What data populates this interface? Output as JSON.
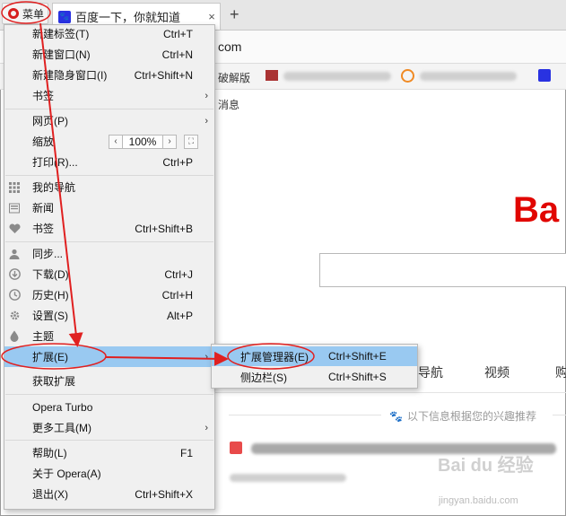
{
  "browser": {
    "menu_button_label": "菜单",
    "tab_title": "百度一下，你就知道",
    "tab_close": "×",
    "new_tab": "+",
    "address_text": "com",
    "bookmark_text": "破解版",
    "page_message": "消息"
  },
  "menu": {
    "items": [
      {
        "label": "新建标签(T)",
        "shortcut": "Ctrl+T",
        "icon": ""
      },
      {
        "label": "新建窗口(N)",
        "shortcut": "Ctrl+N",
        "icon": ""
      },
      {
        "label": "新建隐身窗口(I)",
        "shortcut": "Ctrl+Shift+N",
        "icon": ""
      },
      {
        "label": "书签",
        "shortcut": "",
        "icon": "",
        "submenu": true
      },
      {
        "label": "网页(P)",
        "shortcut": "",
        "icon": "",
        "submenu": true
      },
      {
        "label": "缩放",
        "shortcut": "",
        "icon": ""
      },
      {
        "label": "打印(R)...",
        "shortcut": "Ctrl+P",
        "icon": ""
      },
      {
        "label": "我的导航",
        "shortcut": "",
        "icon": "grid-icon"
      },
      {
        "label": "新闻",
        "shortcut": "",
        "icon": "news-icon"
      },
      {
        "label": "书签",
        "shortcut": "Ctrl+Shift+B",
        "icon": "heart-icon"
      },
      {
        "label": "同步...",
        "shortcut": "",
        "icon": "person-icon"
      },
      {
        "label": "下载(D)",
        "shortcut": "Ctrl+J",
        "icon": "download-icon"
      },
      {
        "label": "历史(H)",
        "shortcut": "Ctrl+H",
        "icon": "clock-icon"
      },
      {
        "label": "设置(S)",
        "shortcut": "Alt+P",
        "icon": "gear-icon"
      },
      {
        "label": "主题",
        "shortcut": "",
        "icon": "drop-icon"
      },
      {
        "label": "扩展(E)",
        "shortcut": "",
        "icon": "",
        "submenu": true,
        "highlighted": true
      },
      {
        "label": "获取扩展",
        "shortcut": "",
        "icon": ""
      },
      {
        "label": "Opera Turbo",
        "shortcut": "",
        "icon": ""
      },
      {
        "label": "更多工具(M)",
        "shortcut": "",
        "icon": "",
        "submenu": true
      },
      {
        "label": "帮助(L)",
        "shortcut": "F1",
        "icon": ""
      },
      {
        "label": "关于 Opera(A)",
        "shortcut": "",
        "icon": ""
      },
      {
        "label": "退出(X)",
        "shortcut": "Ctrl+Shift+X",
        "icon": ""
      }
    ],
    "zoom": {
      "minus": "‹",
      "value": "100%",
      "plus": "›",
      "fit": "⛶"
    },
    "submenu_arrow": "›"
  },
  "submenu": {
    "items": [
      {
        "label": "扩展管理器(E)",
        "shortcut": "Ctrl+Shift+E",
        "highlighted": true
      },
      {
        "label": "侧边栏(S)",
        "shortcut": "Ctrl+Shift+S"
      }
    ]
  },
  "page": {
    "logo_text": "Ba",
    "nav": [
      "导航",
      "视频",
      "购"
    ],
    "recommend_text": "以下信息根据您的兴趣推荐",
    "watermark": "Bai du 经验",
    "watermark_url": "jingyan.baidu.com"
  },
  "colors": {
    "highlight": "#99c9f1",
    "annotation_red": "#e02020",
    "baidu_red": "#e10601",
    "opera_red": "#d61e1e"
  }
}
